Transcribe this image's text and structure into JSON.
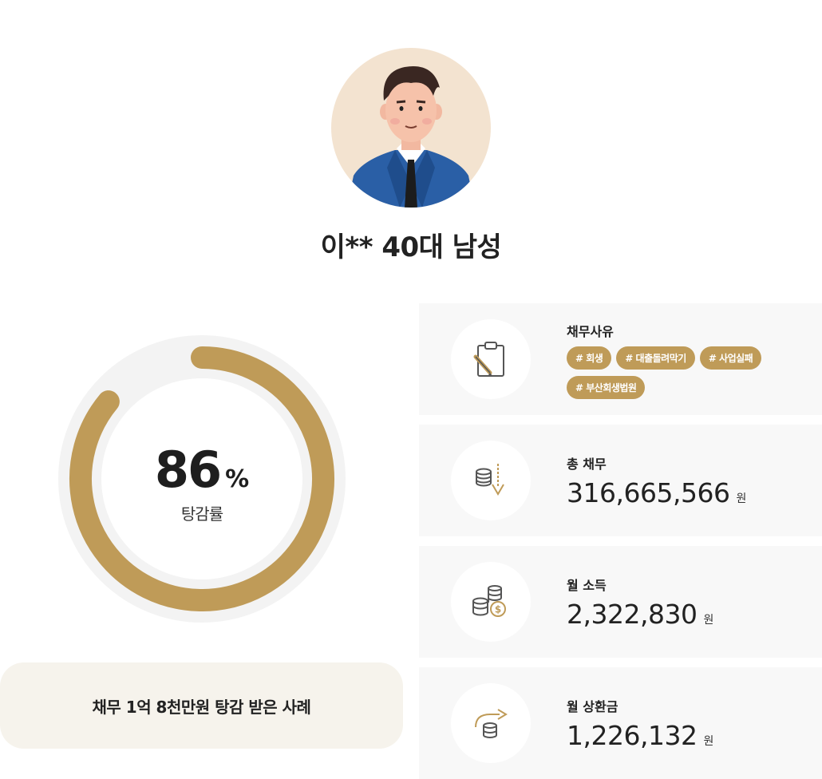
{
  "profile": {
    "title": "이** 40대 남성",
    "avatar_icon": "man-in-suit-avatar"
  },
  "reduction": {
    "percent": 86,
    "value_text": "86",
    "unit": "%",
    "label": "탕감률",
    "ring_color": "#bf9b58",
    "track_color": "#f3f3f3"
  },
  "case_summary": "채무 1억 8천만원 탕감 받은 사례",
  "debt_reason": {
    "label": "채무사유",
    "icon": "clipboard-pen-icon",
    "tags": [
      "# 회생",
      "# 대출돌려막기",
      "# 사업실패",
      "# 부산회생법원"
    ]
  },
  "total_debt": {
    "label": "총 채무",
    "icon": "coins-down-arrow-icon",
    "amount": "316,665,566",
    "unit": "원"
  },
  "monthly_income": {
    "label": "월 소득",
    "icon": "coin-stacks-icon",
    "amount": "2,322,830",
    "unit": "원"
  },
  "monthly_repayment": {
    "label": "월 상환금",
    "icon": "coins-return-arrow-icon",
    "amount": "1,226,132",
    "unit": "원"
  },
  "colors": {
    "accent": "#bf9b58",
    "panel_bg": "#f8f8f8",
    "case_bg": "#f6f3ec"
  }
}
